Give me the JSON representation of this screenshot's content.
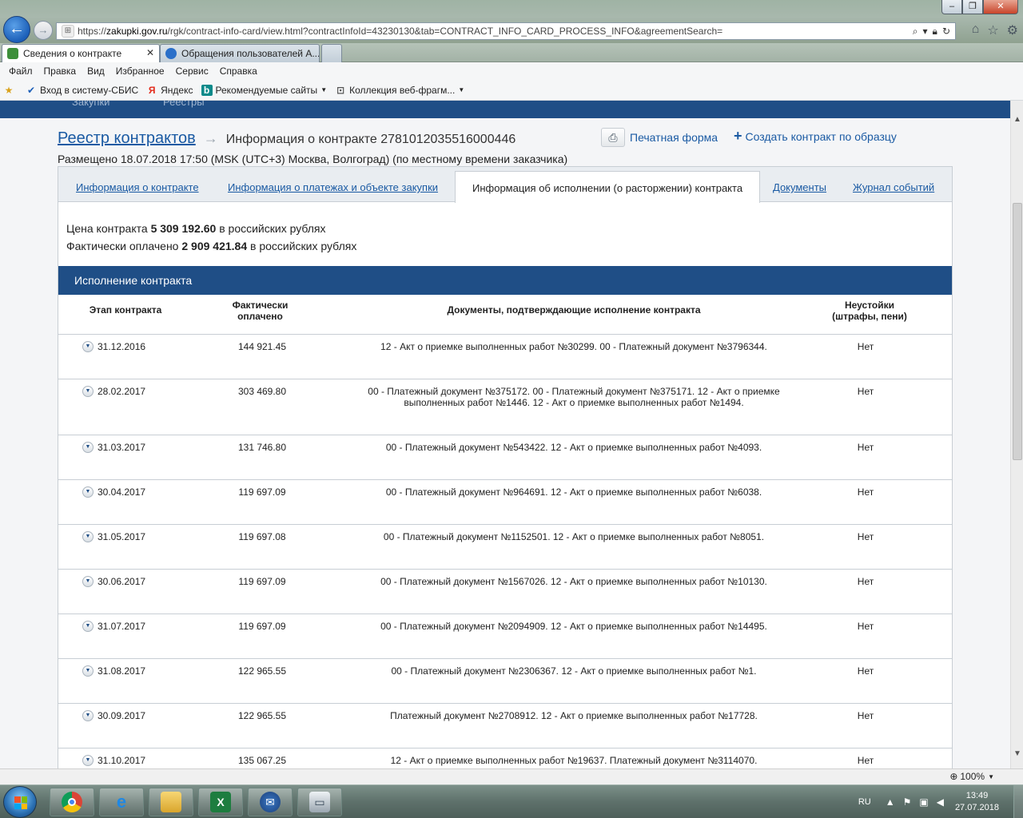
{
  "browser": {
    "url_prefix": "https://",
    "url_domain": "zakupki.gov.ru",
    "url_path": "/rgk/contract-info-card/view.html?contractInfoId=43230130&tab=CONTRACT_INFO_CARD_PROCESS_INFO&agreementSearch=",
    "tabs": [
      {
        "label": "Сведения о контракте",
        "active": true
      },
      {
        "label": "Обращения пользователей А...",
        "active": false
      }
    ],
    "menu": [
      "Файл",
      "Правка",
      "Вид",
      "Избранное",
      "Сервис",
      "Справка"
    ],
    "favorites": [
      {
        "label": "Вход в систему-СБИС",
        "icon": "sbis-icon"
      },
      {
        "label": "Яндекс",
        "icon": "yandex-icon"
      },
      {
        "label": "Рекомендуемые сайты",
        "icon": "bing-icon"
      },
      {
        "label": "Коллекция веб-фрагм...",
        "icon": "webslice-icon"
      }
    ],
    "zoom": "100%"
  },
  "page": {
    "top_nav": [
      "Закупки",
      "Реестры"
    ],
    "breadcrumb_link": "Реестр контрактов",
    "breadcrumb_current": "Информация о контракте 2781012035516000446",
    "placed": "Размещено 18.07.2018 17:50 (MSK (UTC+3) Москва, Волгоград) (по местному времени заказчика)",
    "print_label": "Печатная форма",
    "create_label": "Создать контракт по образцу",
    "tabs": [
      "Информация о контракте",
      "Информация о платежах и объекте закупки",
      "Информация об исполнении (о расторжении) контракта",
      "Документы",
      "Журнал событий"
    ],
    "price_label": "Цена контракта",
    "price_value": "5 309 192.60",
    "price_suffix": "в российских рублях",
    "paid_label": "Фактически оплачено",
    "paid_value": "2 909 421.84",
    "paid_suffix": "в российских рублях",
    "section_title": "Исполнение контракта",
    "columns": {
      "stage": "Этап контракта",
      "paid_l1": "Фактически",
      "paid_l2": "оплачено",
      "docs": "Документы, подтверждающие исполнение контракта",
      "pen_l1": "Неустойки",
      "pen_l2": "(штрафы, пени)"
    },
    "rows": [
      {
        "stage": "31.12.2016",
        "paid": "144 921.45",
        "docs": "12 - Акт о приемке выполненных работ №30299. 00 - Платежный документ №3796344.",
        "penalty": "Нет"
      },
      {
        "stage": "28.02.2017",
        "paid": "303 469.80",
        "docs": "00 - Платежный документ №375172. 00 - Платежный документ №375171. 12 - Акт о приемке выполненных работ №1446. 12 - Акт о приемке выполненных работ №1494.",
        "penalty": "Нет"
      },
      {
        "stage": "31.03.2017",
        "paid": "131 746.80",
        "docs": "00 - Платежный документ №543422. 12 - Акт о приемке выполненных работ №4093.",
        "penalty": "Нет"
      },
      {
        "stage": "30.04.2017",
        "paid": "119 697.09",
        "docs": "00 - Платежный документ №964691. 12 - Акт о приемке выполненных работ №6038.",
        "penalty": "Нет"
      },
      {
        "stage": "31.05.2017",
        "paid": "119 697.08",
        "docs": "00 - Платежный документ №1152501. 12 - Акт о приемке выполненных работ №8051.",
        "penalty": "Нет"
      },
      {
        "stage": "30.06.2017",
        "paid": "119 697.09",
        "docs": "00 - Платежный документ №1567026. 12 - Акт о приемке выполненных работ №10130.",
        "penalty": "Нет"
      },
      {
        "stage": "31.07.2017",
        "paid": "119 697.09",
        "docs": "00 - Платежный документ №2094909. 12 - Акт о приемке выполненных работ №14495.",
        "penalty": "Нет"
      },
      {
        "stage": "31.08.2017",
        "paid": "122 965.55",
        "docs": "00 - Платежный документ №2306367. 12 - Акт о приемке выполненных работ №1.",
        "penalty": "Нет"
      },
      {
        "stage": "30.09.2017",
        "paid": "122 965.55",
        "docs": "Платежный документ №2708912. 12 - Акт о приемке выполненных работ №17728.",
        "penalty": "Нет"
      },
      {
        "stage": "31.10.2017",
        "paid": "135 067.25",
        "docs": "12 - Акт о приемке выполненных работ №19637. Платежный документ №3114070.",
        "penalty": "Нет"
      }
    ]
  },
  "taskbar": {
    "apps": [
      "chrome-icon",
      "internet-explorer-icon",
      "file-explorer-icon",
      "excel-icon",
      "thunderbird-icon",
      "scanner-icon"
    ],
    "lang": "RU",
    "time": "13:49",
    "date": "27.07.2018"
  },
  "colors": {
    "accent_blue": "#1f4e86",
    "link_blue": "#1a5aa3"
  }
}
